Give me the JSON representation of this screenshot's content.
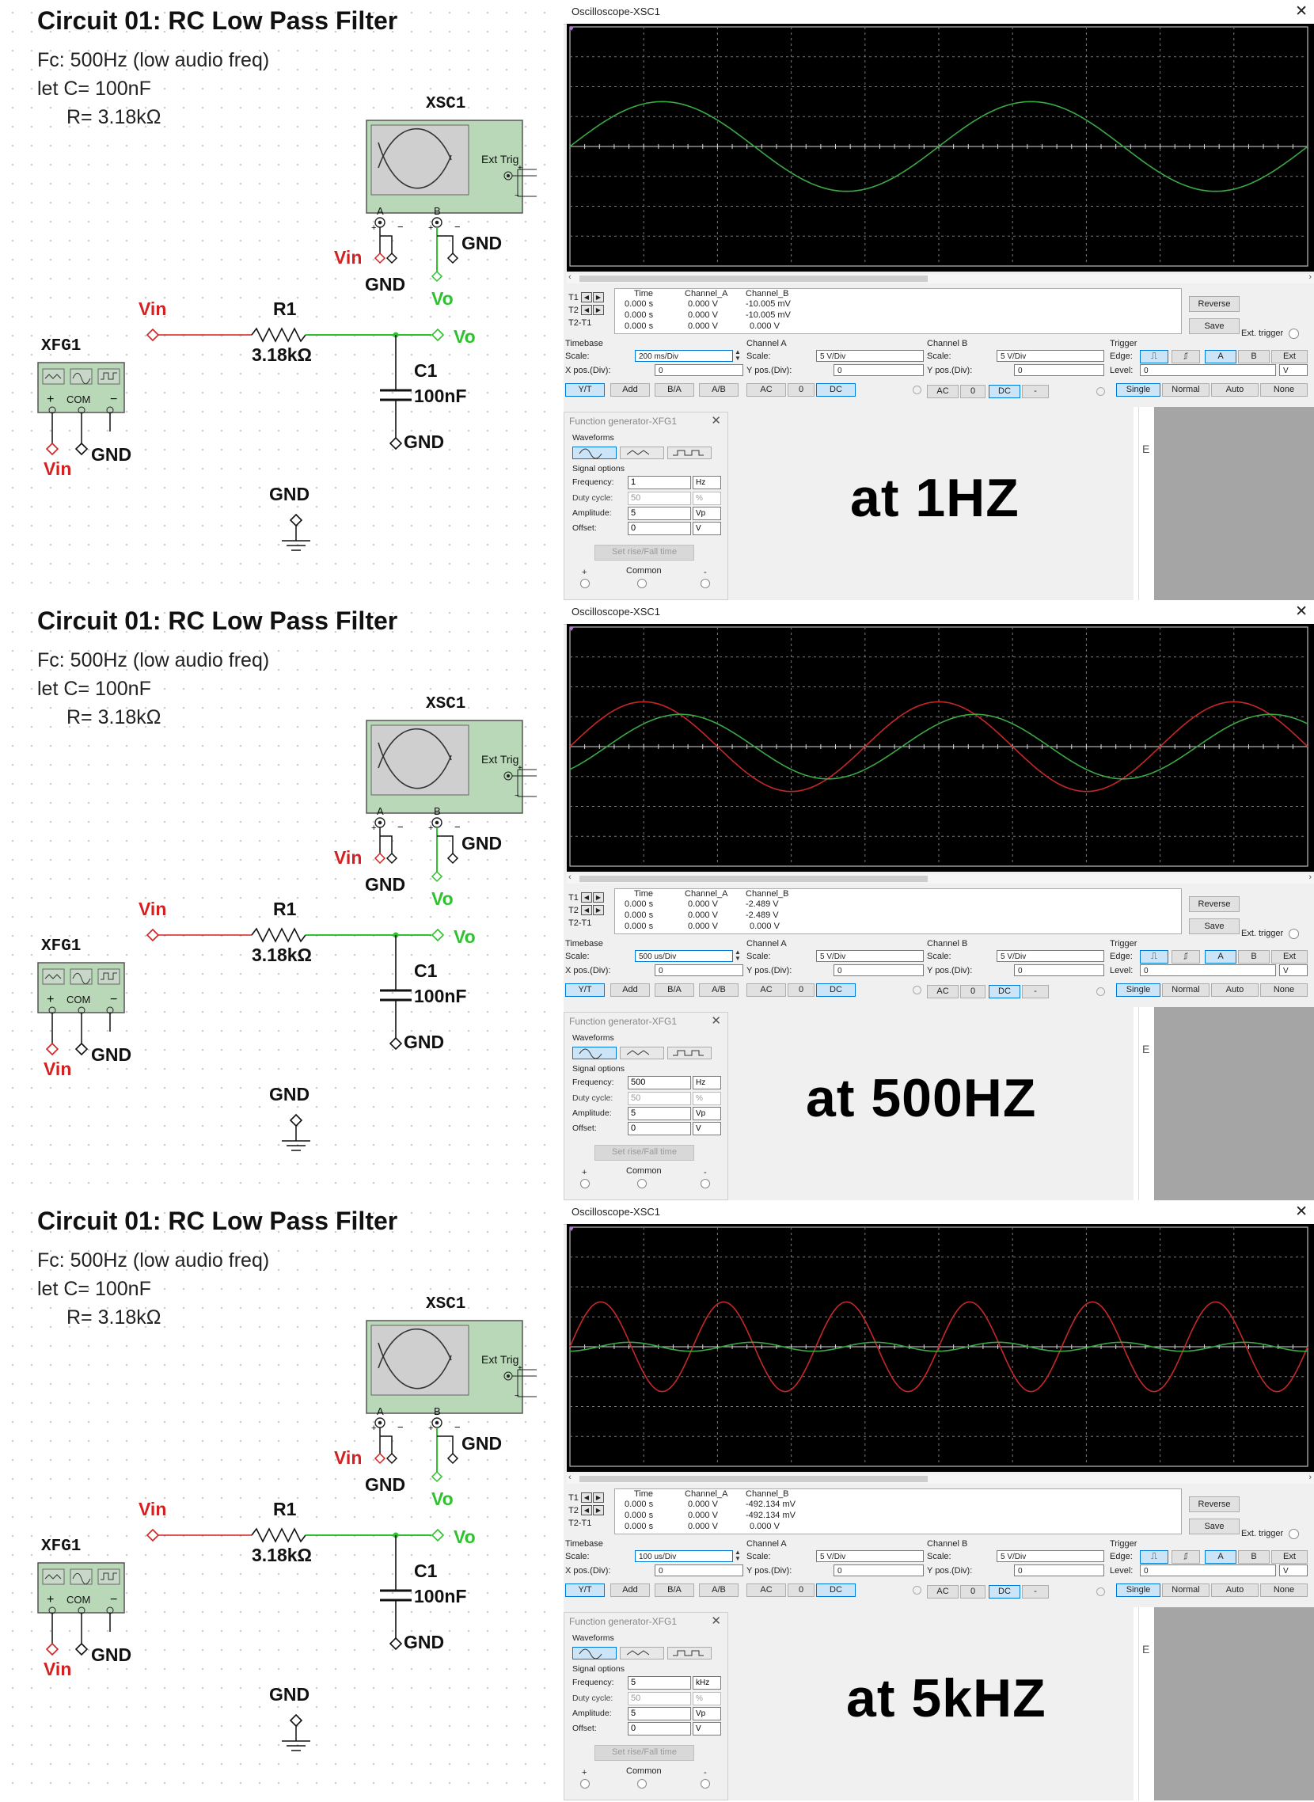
{
  "panels": [
    {
      "circuit": {
        "title": "Circuit 01: RC Low Pass Filter",
        "fc_line": "Fc: 500Hz (low audio freq)",
        "c_line": "let C= 100nF",
        "r_line": "R= 3.18kΩ",
        "scope_ref": "XSC1",
        "ext_trig": "Ext Trig",
        "gen_ref": "XFG1",
        "com_label": "COM",
        "res_ref": "R1",
        "res_value": "3.18kΩ",
        "cap_ref": "C1",
        "cap_value": "100nF",
        "vin": "Vin",
        "vo": "Vo",
        "gnd": "GND",
        "ch_a": "A",
        "ch_b": "B"
      },
      "oscilloscope": {
        "title": "Oscilloscope-XSC1",
        "trace_periods": 2,
        "vin_amplitude_div": 0,
        "vo_amplitude_div": 1,
        "vo_phase_lag_deg": 0,
        "colors": {
          "channel_a": "#c62828",
          "channel_b": "#3aa845"
        },
        "measurements": {
          "headers": [
            "Time",
            "Channel_A",
            "Channel_B"
          ],
          "rows": [
            {
              "label": "T1",
              "time": "0.000 s",
              "a": "0.000 V",
              "b": "-10.005 mV"
            },
            {
              "label": "T2",
              "time": "0.000 s",
              "a": "0.000 V",
              "b": "-10.005 mV"
            },
            {
              "label": "T2-T1",
              "time": "0.000 s",
              "a": "0.000 V",
              "b": "0.000 V"
            }
          ]
        },
        "buttons": {
          "reverse": "Reverse",
          "save": "Save",
          "ext_trigger": "Ext. trigger"
        },
        "timebase": {
          "header": "Timebase",
          "scale_label": "Scale:",
          "scale": "200 ms/Div",
          "xpos_label": "X pos.(Div):",
          "xpos": "0",
          "modes": [
            "Y/T",
            "Add",
            "B/A",
            "A/B"
          ]
        },
        "channel_a": {
          "header": "Channel A",
          "scale_label": "Scale:",
          "scale": "5  V/Div",
          "ypos_label": "Y pos.(Div):",
          "ypos": "0",
          "coupling": [
            "AC",
            "0",
            "DC"
          ]
        },
        "channel_b": {
          "header": "Channel B",
          "scale_label": "Scale:",
          "scale": "5  V/Div",
          "ypos_label": "Y pos.(Div):",
          "ypos": "0",
          "coupling": [
            "AC",
            "0",
            "DC",
            "-"
          ]
        },
        "trigger": {
          "header": "Trigger",
          "edge_label": "Edge:",
          "level_label": "Level:",
          "level": "0",
          "level_unit": "V",
          "sources": [
            "A",
            "B",
            "Ext"
          ],
          "modes": [
            "Single",
            "Normal",
            "Auto",
            "None"
          ]
        }
      },
      "generator": {
        "title": "Function generator-XFG1",
        "waveforms_label": "Waveforms",
        "signal_options_label": "Signal options",
        "frequency_label": "Frequency:",
        "frequency": "1",
        "frequency_unit": "Hz",
        "duty_label": "Duty cycle:",
        "duty": "50",
        "duty_unit": "%",
        "amplitude_label": "Amplitude:",
        "amplitude": "5",
        "amplitude_unit": "Vp",
        "offset_label": "Offset:",
        "offset": "0",
        "offset_unit": "V",
        "rise_fall": "Set rise/Fall time",
        "plus": "+",
        "common": "Common",
        "minus": "-"
      },
      "caption": "at 1HZ"
    },
    {
      "circuit": {
        "title": "Circuit 01: RC Low Pass Filter",
        "fc_line": "Fc: 500Hz (low audio freq)",
        "c_line": "let C= 100nF",
        "r_line": "R= 3.18kΩ",
        "scope_ref": "XSC1",
        "ext_trig": "Ext Trig",
        "gen_ref": "XFG1",
        "com_label": "COM",
        "res_ref": "R1",
        "res_value": "3.18kΩ",
        "cap_ref": "C1",
        "cap_value": "100nF",
        "vin": "Vin",
        "vo": "Vo",
        "gnd": "GND",
        "ch_a": "A",
        "ch_b": "B"
      },
      "oscilloscope": {
        "title": "Oscilloscope-XSC1",
        "trace_periods": 2.5,
        "vin_amplitude_div": 1,
        "vo_amplitude_div": 0.72,
        "vo_phase_lag_deg": 45,
        "colors": {
          "channel_a": "#c62828",
          "channel_b": "#3aa845"
        },
        "measurements": {
          "headers": [
            "Time",
            "Channel_A",
            "Channel_B"
          ],
          "rows": [
            {
              "label": "T1",
              "time": "0.000 s",
              "a": "0.000 V",
              "b": "-2.489 V"
            },
            {
              "label": "T2",
              "time": "0.000 s",
              "a": "0.000 V",
              "b": "-2.489 V"
            },
            {
              "label": "T2-T1",
              "time": "0.000 s",
              "a": "0.000 V",
              "b": "0.000 V"
            }
          ]
        },
        "buttons": {
          "reverse": "Reverse",
          "save": "Save",
          "ext_trigger": "Ext. trigger"
        },
        "timebase": {
          "header": "Timebase",
          "scale_label": "Scale:",
          "scale": "500 us/Div",
          "xpos_label": "X pos.(Div):",
          "xpos": "0",
          "modes": [
            "Y/T",
            "Add",
            "B/A",
            "A/B"
          ]
        },
        "channel_a": {
          "header": "Channel A",
          "scale_label": "Scale:",
          "scale": "5  V/Div",
          "ypos_label": "Y pos.(Div):",
          "ypos": "0",
          "coupling": [
            "AC",
            "0",
            "DC"
          ]
        },
        "channel_b": {
          "header": "Channel B",
          "scale_label": "Scale:",
          "scale": "5  V/Div",
          "ypos_label": "Y pos.(Div):",
          "ypos": "0",
          "coupling": [
            "AC",
            "0",
            "DC",
            "-"
          ]
        },
        "trigger": {
          "header": "Trigger",
          "edge_label": "Edge:",
          "level_label": "Level:",
          "level": "0",
          "level_unit": "V",
          "sources": [
            "A",
            "B",
            "Ext"
          ],
          "modes": [
            "Single",
            "Normal",
            "Auto",
            "None"
          ]
        }
      },
      "generator": {
        "title": "Function generator-XFG1",
        "waveforms_label": "Waveforms",
        "signal_options_label": "Signal options",
        "frequency_label": "Frequency:",
        "frequency": "500",
        "frequency_unit": "Hz",
        "duty_label": "Duty cycle:",
        "duty": "50",
        "duty_unit": "%",
        "amplitude_label": "Amplitude:",
        "amplitude": "5",
        "amplitude_unit": "Vp",
        "offset_label": "Offset:",
        "offset": "0",
        "offset_unit": "V",
        "rise_fall": "Set rise/Fall time",
        "plus": "+",
        "common": "Common",
        "minus": "-"
      },
      "caption": "at 500HZ"
    },
    {
      "circuit": {
        "title": "Circuit 01: RC Low Pass Filter",
        "fc_line": "Fc: 500Hz (low audio freq)",
        "c_line": "let C= 100nF",
        "r_line": "R= 3.18kΩ",
        "scope_ref": "XSC1",
        "ext_trig": "Ext Trig",
        "gen_ref": "XFG1",
        "com_label": "COM",
        "res_ref": "R1",
        "res_value": "3.18kΩ",
        "cap_ref": "C1",
        "cap_value": "100nF",
        "vin": "Vin",
        "vo": "Vo",
        "gnd": "GND",
        "ch_a": "A",
        "ch_b": "B"
      },
      "oscilloscope": {
        "title": "Oscilloscope-XSC1",
        "trace_periods": 6,
        "vin_amplitude_div": 1,
        "vo_amplitude_div": 0.1,
        "vo_phase_lag_deg": 84,
        "colors": {
          "channel_a": "#c62828",
          "channel_b": "#3aa845"
        },
        "measurements": {
          "headers": [
            "Time",
            "Channel_A",
            "Channel_B"
          ],
          "rows": [
            {
              "label": "T1",
              "time": "0.000 s",
              "a": "0.000 V",
              "b": "-492.134 mV"
            },
            {
              "label": "T2",
              "time": "0.000 s",
              "a": "0.000 V",
              "b": "-492.134 mV"
            },
            {
              "label": "T2-T1",
              "time": "0.000 s",
              "a": "0.000 V",
              "b": "0.000 V"
            }
          ]
        },
        "buttons": {
          "reverse": "Reverse",
          "save": "Save",
          "ext_trigger": "Ext. trigger"
        },
        "timebase": {
          "header": "Timebase",
          "scale_label": "Scale:",
          "scale": "100 us/Div",
          "xpos_label": "X pos.(Div):",
          "xpos": "0",
          "modes": [
            "Y/T",
            "Add",
            "B/A",
            "A/B"
          ]
        },
        "channel_a": {
          "header": "Channel A",
          "scale_label": "Scale:",
          "scale": "5  V/Div",
          "ypos_label": "Y pos.(Div):",
          "ypos": "0",
          "coupling": [
            "AC",
            "0",
            "DC"
          ]
        },
        "channel_b": {
          "header": "Channel B",
          "scale_label": "Scale:",
          "scale": "5  V/Div",
          "ypos_label": "Y pos.(Div):",
          "ypos": "0",
          "coupling": [
            "AC",
            "0",
            "DC",
            "-"
          ]
        },
        "trigger": {
          "header": "Trigger",
          "edge_label": "Edge:",
          "level_label": "Level:",
          "level": "0",
          "level_unit": "V",
          "sources": [
            "A",
            "B",
            "Ext"
          ],
          "modes": [
            "Single",
            "Normal",
            "Auto",
            "None"
          ]
        }
      },
      "generator": {
        "title": "Function generator-XFG1",
        "waveforms_label": "Waveforms",
        "signal_options_label": "Signal options",
        "frequency_label": "Frequency:",
        "frequency": "5",
        "frequency_unit": "kHz",
        "duty_label": "Duty cycle:",
        "duty": "50",
        "duty_unit": "%",
        "amplitude_label": "Amplitude:",
        "amplitude": "5",
        "amplitude_unit": "Vp",
        "offset_label": "Offset:",
        "offset": "0",
        "offset_unit": "V",
        "rise_fall": "Set rise/Fall time",
        "plus": "+",
        "common": "Common",
        "minus": "-"
      },
      "caption": "at 5kHZ"
    }
  ]
}
